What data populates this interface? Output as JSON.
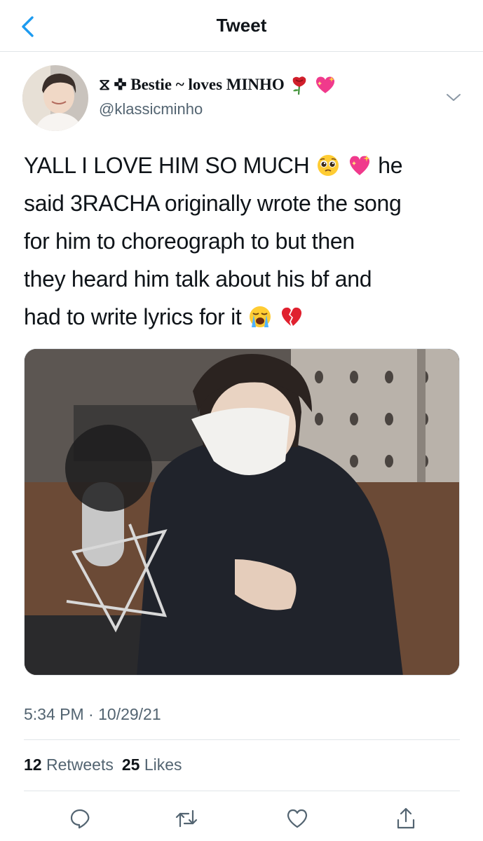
{
  "nav": {
    "title": "Tweet",
    "back_icon": "chevron-left-icon"
  },
  "author": {
    "name_prefix": "⧖ ✜",
    "name_text": "Bestie ~ loves MINHO",
    "handle": "@klassicminho",
    "name_emojis": [
      "rose-emoji",
      "sparkling-heart-emoji"
    ]
  },
  "tweet": {
    "line1": "YALL I LOVE HIM SO MUCH",
    "line1_end": "he",
    "line2": "said 3RACHA originally wrote the song",
    "line3": "for him to choreograph to but then",
    "line4": "they heard him talk about his bf and",
    "line5": "had to write lyrics for it"
  },
  "meta": {
    "time": "5:34 PM",
    "sep": "·",
    "date": "10/29/21"
  },
  "stats": {
    "retweets_count": "12",
    "retweets_label": "Retweets",
    "likes_count": "25",
    "likes_label": "Likes"
  },
  "actions": [
    "reply-icon",
    "retweet-icon",
    "like-icon",
    "share-icon"
  ],
  "colors": {
    "accent": "#1d9bf0",
    "secondary_text": "#536471",
    "divider": "#e1e5e8"
  }
}
